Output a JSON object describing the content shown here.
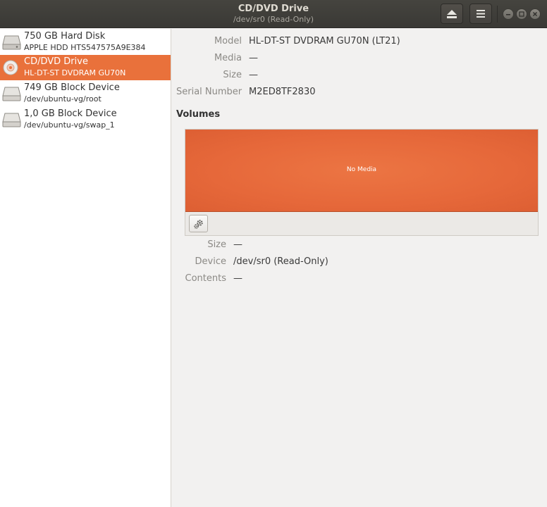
{
  "header": {
    "title": "CD/DVD Drive",
    "subtitle": "/dev/sr0 (Read-Only)",
    "eject_icon": "eject-icon",
    "menu_icon": "hamburger-menu-icon"
  },
  "sidebar": {
    "items": [
      {
        "name": "750 GB Hard Disk",
        "desc": "APPLE HDD HTS547575A9E384",
        "icon": "hard-disk-icon",
        "selected": false
      },
      {
        "name": "CD/DVD Drive",
        "desc": "HL-DT-ST DVDRAM GU70N",
        "icon": "optical-disc-icon",
        "selected": true
      },
      {
        "name": "749 GB Block Device",
        "desc": "/dev/ubuntu-vg/root",
        "icon": "block-device-icon",
        "selected": false
      },
      {
        "name": "1,0 GB Block Device",
        "desc": "/dev/ubuntu-vg/swap_1",
        "icon": "block-device-icon",
        "selected": false
      }
    ]
  },
  "drive": {
    "model_label": "Model",
    "model": "HL-DT-ST DVDRAM GU70N (LT21)",
    "media_label": "Media",
    "media": "—",
    "size_label": "Size",
    "size": "—",
    "serial_label": "Serial Number",
    "serial": "M2ED8TF2830"
  },
  "volumes": {
    "title": "Volumes",
    "bar_label": "No Media",
    "accent": "#e9713b",
    "size_label": "Size",
    "size": "—",
    "device_label": "Device",
    "device": "/dev/sr0 (Read-Only)",
    "contents_label": "Contents",
    "contents": "—"
  }
}
